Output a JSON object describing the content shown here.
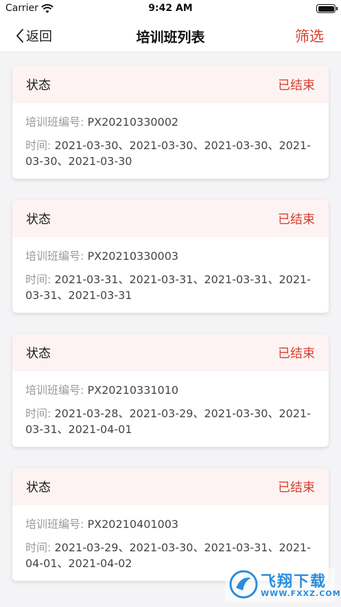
{
  "status_bar": {
    "carrier": "Carrier",
    "time": "9:42 AM"
  },
  "nav": {
    "back_label": "返回",
    "title": "培训班列表",
    "filter_label": "筛选"
  },
  "colors": {
    "accent": "#d9402f",
    "card_header_bg": "#fdf3f3",
    "page_bg": "#f4f4f6"
  },
  "cards": [
    {
      "status_label": "状态",
      "status": "已结束",
      "code_label": "培训班编号:",
      "code": "PX20210330002",
      "time_label": "时间:",
      "time": "2021-03-30、2021-03-30、2021-03-30、2021-03-30、2021-03-30"
    },
    {
      "status_label": "状态",
      "status": "已结束",
      "code_label": "培训班编号:",
      "code": "PX20210330003",
      "time_label": "时间:",
      "time": "2021-03-31、2021-03-31、2021-03-31、2021-03-31、2021-03-31"
    },
    {
      "status_label": "状态",
      "status": "已结束",
      "code_label": "培训班编号:",
      "code": "PX20210331010",
      "time_label": "时间:",
      "time": "2021-03-28、2021-03-29、2021-03-30、2021-03-31、2021-04-01"
    },
    {
      "status_label": "状态",
      "status": "已结束",
      "code_label": "培训班编号:",
      "code": "PX20210401003",
      "time_label": "时间:",
      "time": "2021-03-29、2021-03-30、2021-03-31、2021-04-01、2021-04-02"
    }
  ],
  "watermark": {
    "text": "飞翔下载",
    "url": "WWW.FXXZ.COM"
  }
}
